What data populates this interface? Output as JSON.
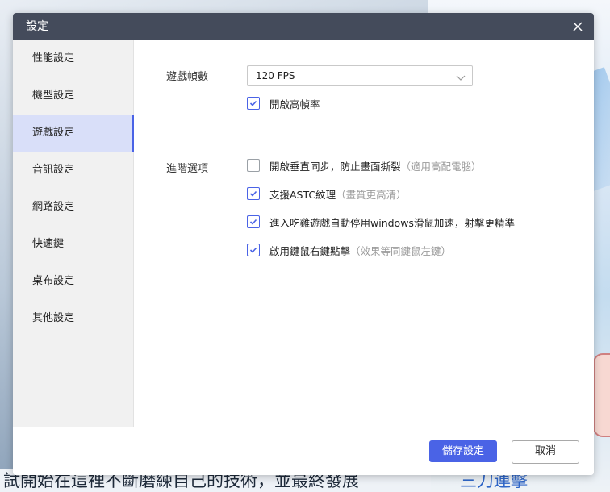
{
  "dialog": {
    "title": "設定"
  },
  "sidebar": {
    "items": [
      {
        "label": "性能設定"
      },
      {
        "label": "機型設定"
      },
      {
        "label": "遊戲設定",
        "active": true
      },
      {
        "label": "音訊設定"
      },
      {
        "label": "網路設定"
      },
      {
        "label": "快速鍵"
      },
      {
        "label": "桌布設定"
      },
      {
        "label": "其他設定"
      }
    ]
  },
  "game": {
    "fps_label": "遊戲幀數",
    "fps_value": "120 FPS",
    "high_fps": {
      "label": "開啟高幀率",
      "checked": true
    },
    "advanced_label": "進階選項",
    "options": [
      {
        "label": "開啟垂直同步，防止畫面撕裂",
        "note": "（適用高配電腦）",
        "checked": false
      },
      {
        "label": "支援ASTC紋理",
        "note": "（畫質更高清）",
        "checked": true
      },
      {
        "label": "進入吃雞遊戲自動停用windows滑鼠加速，射擊更精準",
        "note": "",
        "checked": true
      },
      {
        "label": "啟用鍵鼠右鍵點擊",
        "note": "（效果等同鍵鼠左鍵）",
        "checked": true
      }
    ]
  },
  "footer": {
    "save_label": "儲存設定",
    "cancel_label": "取消"
  },
  "background": {
    "bottom_left_text": "試開始在這裡不斷磨練自己的技術，並最終發展",
    "bottom_right_text": "三刀連擊"
  },
  "colors": {
    "accent": "#4a63e6",
    "titlebar": "#444b5b",
    "sidebar_active": "#d9dff9"
  }
}
